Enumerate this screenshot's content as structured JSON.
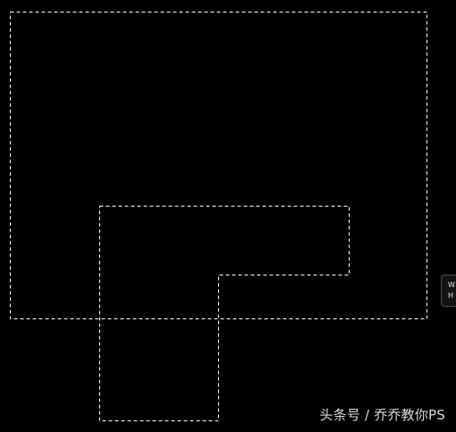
{
  "canvas": {
    "background": "#000000",
    "selection_color": "#ffffff"
  },
  "info_overlay": {
    "width_label": "W",
    "height_label": "H"
  },
  "watermark": {
    "text": "头条号 / 乔乔教你PS"
  }
}
